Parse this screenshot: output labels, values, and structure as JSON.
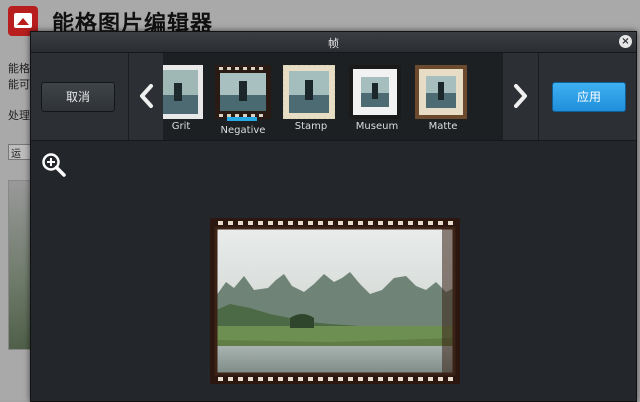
{
  "app": {
    "title": "能格图片编辑器",
    "desc_line1": "能格",
    "desc_line2": "能可",
    "process_label": "处理",
    "tab_label": "运"
  },
  "dialog": {
    "title": "帧",
    "close": "×"
  },
  "toolbar": {
    "cancel_label": "取消",
    "apply_label": "应用"
  },
  "frames": [
    {
      "label": "Grit"
    },
    {
      "label": "Negative",
      "selected": true
    },
    {
      "label": "Stamp"
    },
    {
      "label": "Museum"
    },
    {
      "label": "Matte"
    }
  ],
  "colors": {
    "accent": "#1f8fda",
    "dialog_bg": "#23272b",
    "selected_indicator": "#29a8e6"
  },
  "icons": {
    "prev": "chevron-left-icon",
    "next": "chevron-right-icon",
    "zoom": "zoom-in-icon",
    "close": "close-icon"
  }
}
